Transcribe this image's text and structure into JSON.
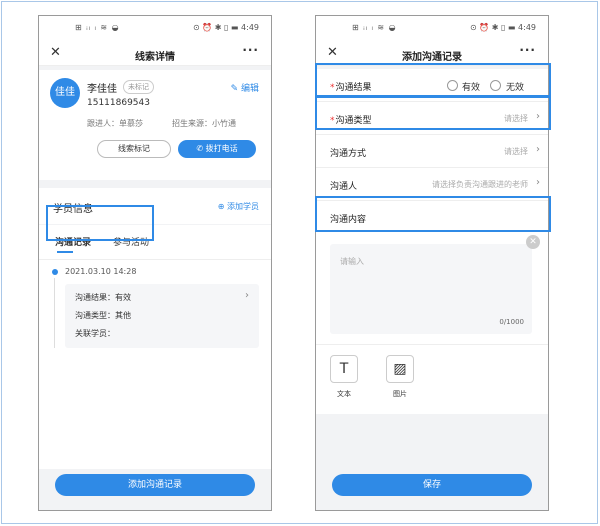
{
  "status_bar": {
    "left": "⊞ ᵢₗ ₗ ≋ ◒",
    "right": "⊙ ⏰ ✱ ▯ ▬ 4:49"
  },
  "left": {
    "nav": {
      "close": "✕",
      "title": "线索详情",
      "more": "···"
    },
    "lead": {
      "avatar": "佳佳",
      "name": "李佳佳",
      "tag": "未标记",
      "edit": "✎ 编辑",
      "phone": "15111869543",
      "follower": "跟进人：单慕莎",
      "source": "招生来源：小竹通",
      "mark_btn": "线索标记",
      "call_btn": "✆ 拨打电话"
    },
    "section": {
      "title": "学员信息",
      "add": "⊕ 添加学员"
    },
    "tabs": [
      "沟通记录",
      "参与活动"
    ],
    "record": {
      "date": "2021.03.10 14:28",
      "result": "沟通结果：有效",
      "type": "沟通类型：其他",
      "student": "关联学员：",
      "chevron": "›"
    },
    "bottom_btn": "添加沟通记录"
  },
  "right": {
    "nav": {
      "close": "✕",
      "title": "添加沟通记录",
      "more": "···"
    },
    "fields": {
      "result_label": "沟通结果",
      "result_opt1": "有效",
      "result_opt2": "无效",
      "type_label": "沟通类型",
      "type_placeholder": "请选择",
      "method_label": "沟通方式",
      "method_placeholder": "请选择",
      "person_label": "沟通人",
      "person_placeholder": "请选择负责沟通跟进的老师",
      "content_label": "沟通内容",
      "required_mark": "*",
      "chevron": "›"
    },
    "textarea": {
      "placeholder": "请输入",
      "count": "0/1000",
      "clear": "✕"
    },
    "attachments": [
      {
        "icon": "T",
        "label": "文本"
      },
      {
        "icon": "▨",
        "label": "图片"
      }
    ],
    "save_btn": "保存"
  },
  "colors": {
    "accent": "#2f8ae6",
    "highlight": "#2f8ae6",
    "required": "#e33333"
  }
}
